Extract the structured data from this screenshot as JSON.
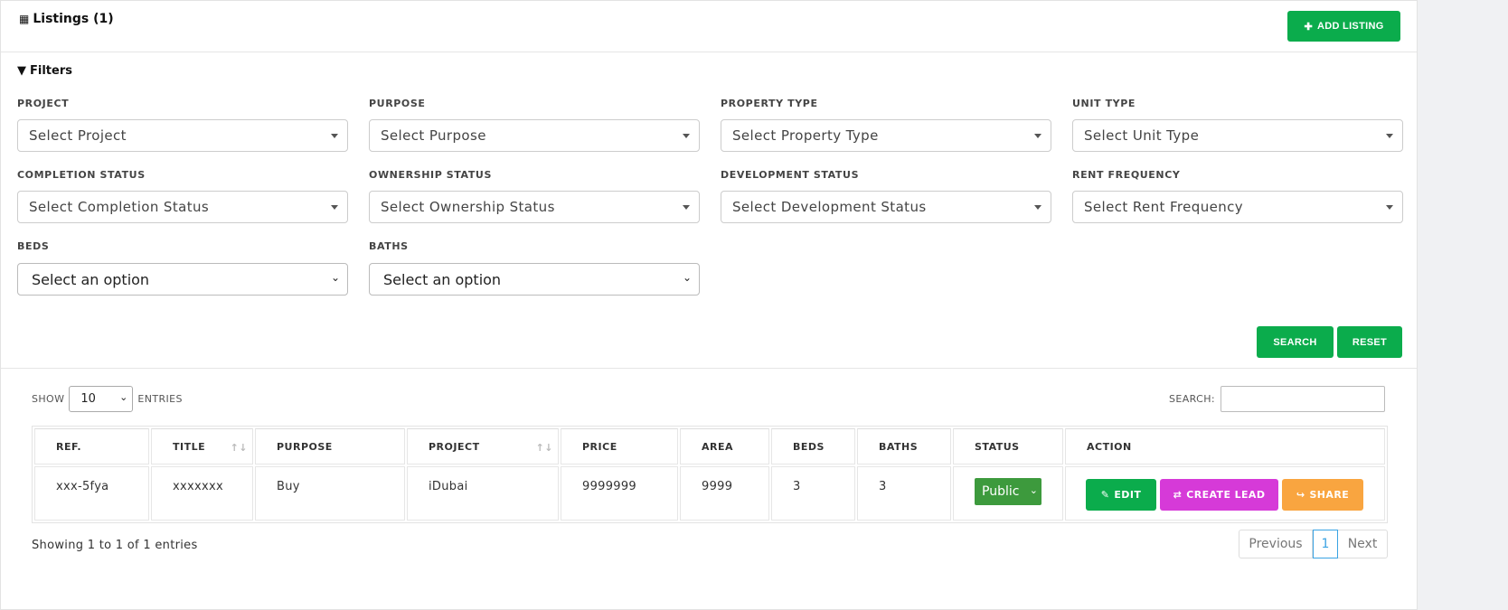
{
  "header": {
    "title": "Listings (1)",
    "add_label": "ADD LISTING"
  },
  "filters": {
    "title": "Filters",
    "fields": [
      {
        "label": "PROJECT",
        "value": "Select Project"
      },
      {
        "label": "PURPOSE",
        "value": "Select Purpose"
      },
      {
        "label": "PROPERTY TYPE",
        "value": "Select Property Type"
      },
      {
        "label": "UNIT TYPE",
        "value": "Select Unit Type"
      },
      {
        "label": "COMPLETION STATUS",
        "value": "Select Completion Status"
      },
      {
        "label": "OWNERSHIP STATUS",
        "value": "Select Ownership Status"
      },
      {
        "label": "DEVELOPMENT STATUS",
        "value": "Select Development Status"
      },
      {
        "label": "RENT FREQUENCY",
        "value": "Select Rent Frequency"
      },
      {
        "label": "BEDS",
        "value": "Select an option"
      },
      {
        "label": "BATHS",
        "value": "Select an option"
      }
    ],
    "search_label": "SEARCH",
    "reset_label": "RESET"
  },
  "table_controls": {
    "show_label": "SHOW",
    "entries_value": "10",
    "entries_label": "ENTRIES",
    "search_label": "SEARCH:"
  },
  "table": {
    "columns": [
      "REF.",
      "TITLE",
      "PURPOSE",
      "PROJECT",
      "PRICE",
      "AREA",
      "BEDS",
      "BATHS",
      "STATUS",
      "ACTION"
    ],
    "rows": [
      {
        "ref": "xxx-5fya",
        "title": "xxxxxxx",
        "purpose": "Buy",
        "project": "iDubai",
        "price": "9999999",
        "area": "9999",
        "beds": "3",
        "baths": "3",
        "status": "Public"
      }
    ],
    "actions": {
      "edit": "EDIT",
      "lead": "CREATE LEAD",
      "share": "SHARE"
    }
  },
  "footer": {
    "info": "Showing 1 to 1 of 1 entries",
    "prev": "Previous",
    "page": "1",
    "next": "Next"
  },
  "colors": {
    "primary_green": "#0bac4c",
    "lead_magenta": "#d63ad8",
    "share_orange": "#f9a540",
    "status_green": "#3d9a3d"
  }
}
